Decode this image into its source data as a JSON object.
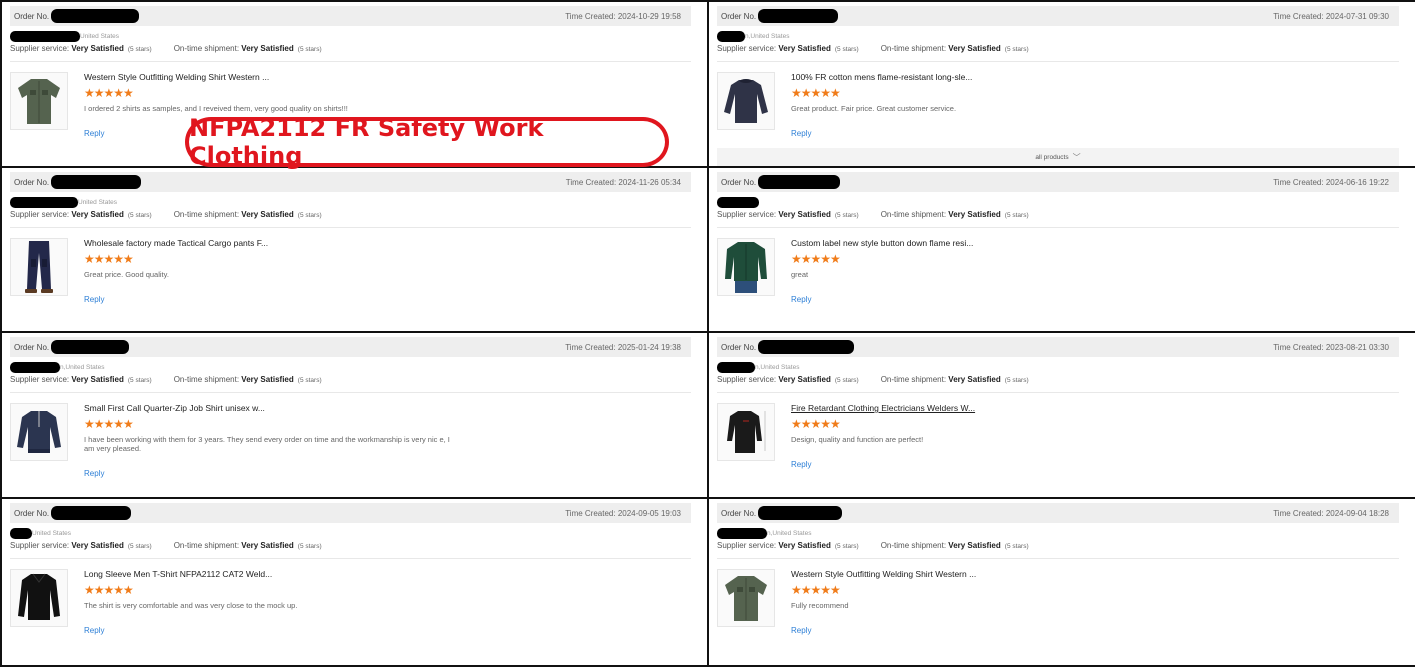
{
  "labels": {
    "order_prefix": "Order No.",
    "time_prefix": "Time Created:",
    "supplier_service": "Supplier service:",
    "on_time": "On-time shipment:",
    "reply": "Reply",
    "all_products": "all products"
  },
  "banner": {
    "text": "NFPA2112 FR Safety Work Clothing"
  },
  "reviews": [
    {
      "time": "2024-10-29 19:58",
      "location": "United States",
      "supplier_rating": "Very Satisfied",
      "supplier_stars": "(5 stars)",
      "shipment_rating": "Very Satisfied",
      "shipment_stars": "(5 stars)",
      "product_title": "Western Style Outfitting Welding Shirt Western ...",
      "stars": "★★★★★",
      "review": "I ordered 2 shirts as samples, and I reveived them, very good quality on shirts!!!",
      "product_icon": "green-work-shirt"
    },
    {
      "time": "2024-07-31 09:30",
      "location": "n,United States",
      "supplier_rating": "Very Satisfied",
      "supplier_stars": "(5 stars)",
      "shipment_rating": "Very Satisfied",
      "shipment_stars": "(5 stars)",
      "product_title": "100% FR cotton mens flame-resistant long-sle...",
      "stars": "★★★★★",
      "review": "Great product. Fair price. Great customer service.",
      "product_icon": "navy-long-sleeve-shirt"
    },
    {
      "time": "2024-11-26 05:34",
      "location": "United States",
      "supplier_rating": "Very Satisfied",
      "supplier_stars": "(5 stars)",
      "shipment_rating": "Very Satisfied",
      "shipment_stars": "(5 stars)",
      "product_title": "Wholesale factory made Tactical Cargo pants F...",
      "stars": "★★★★★",
      "review": "Great price. Good quality.",
      "product_icon": "navy-cargo-pants"
    },
    {
      "time": "2024-06-16 19:22",
      "location": "",
      "supplier_rating": "Very Satisfied",
      "supplier_stars": "(5 stars)",
      "shipment_rating": "Very Satisfied",
      "shipment_stars": "(5 stars)",
      "product_title": "Custom label new style button down flame resi...",
      "stars": "★★★★★",
      "review": "great",
      "product_icon": "green-button-shirt"
    },
    {
      "time": "2025-01-24 19:38",
      "location": "n,United States",
      "supplier_rating": "Very Satisfied",
      "supplier_stars": "(5 stars)",
      "shipment_rating": "Very Satisfied",
      "shipment_stars": "(5 stars)",
      "product_title": "Small First Call Quarter-Zip Job Shirt unisex w...",
      "stars": "★★★★★",
      "review": "I have been working with them for 3 years. They send every order on time and the workmanship is very nic e, I am very pleased.",
      "product_icon": "navy-quarter-zip"
    },
    {
      "time": "2023-08-21 03:30",
      "location": "n,United States",
      "supplier_rating": "Very Satisfied",
      "supplier_stars": "(5 stars)",
      "shipment_rating": "Very Satisfied",
      "shipment_stars": "(5 stars)",
      "product_title": "Fire Retardant Clothing Electricians Welders W...",
      "stars": "★★★★★",
      "review": "Design, quality and function are perfect!",
      "product_icon": "black-fr-shirt"
    },
    {
      "time": "2024-09-05 19:03",
      "location": "United States",
      "supplier_rating": "Very Satisfied",
      "supplier_stars": "(5 stars)",
      "shipment_rating": "Very Satisfied",
      "shipment_stars": "(5 stars)",
      "product_title": "Long Sleeve Men T-Shirt NFPA2112 CAT2 Weld...",
      "stars": "★★★★★",
      "review": "The shirt is very comfortable and was very close to the mock up.",
      "product_icon": "black-polo-shirt"
    },
    {
      "time": "2024-09-04 18:28",
      "location": "n,United States",
      "supplier_rating": "Very Satisfied",
      "supplier_stars": "(5 stars)",
      "shipment_rating": "Very Satisfied",
      "shipment_stars": "(5 stars)",
      "product_title": "Western Style Outfitting Welding Shirt Western ...",
      "stars": "★★★★★",
      "review": "Fully recommend",
      "product_icon": "green-work-shirt"
    }
  ]
}
